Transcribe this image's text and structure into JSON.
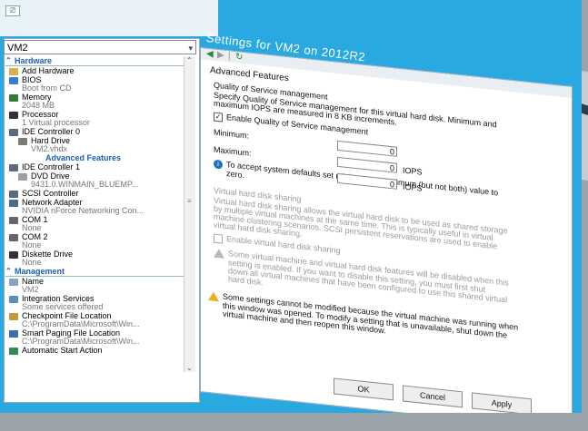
{
  "window": {
    "title": "Settings for VM2 on 2012R2",
    "controls": {
      "minimize": "–",
      "maximize": "□",
      "close": "✕"
    }
  },
  "vm_selector": {
    "value": "VM2"
  },
  "tree": {
    "hardware_header": "Hardware",
    "items": [
      {
        "label": "Add Hardware",
        "sub": "",
        "icon": "add-hardware-icon",
        "color": "#d7b14a"
      },
      {
        "label": "BIOS",
        "sub": "Boot from CD",
        "icon": "bios-icon",
        "color": "#3a7bd5"
      },
      {
        "label": "Memory",
        "sub": "2048 MB",
        "icon": "memory-icon",
        "color": "#2e7d32"
      },
      {
        "label": "Processor",
        "sub": "1 Virtual processor",
        "icon": "processor-icon",
        "color": "#333333"
      },
      {
        "label": "IDE Controller 0",
        "sub": "",
        "icon": "ide-controller-icon",
        "color": "#5a6b7b"
      },
      {
        "label": "Hard Drive",
        "sub": "VM2.vhdx",
        "icon": "hard-drive-icon",
        "color": "#7a7a7a"
      },
      {
        "label": "Advanced Features",
        "sub": "",
        "icon": "",
        "color": "#1a5fb4"
      },
      {
        "label": "IDE Controller 1",
        "sub": "",
        "icon": "ide-controller-icon",
        "color": "#5a6b7b"
      },
      {
        "label": "DVD Drive",
        "sub": "9431.0.WINMAIN_BLUEMP...",
        "icon": "dvd-drive-icon",
        "color": "#9aa0a6"
      },
      {
        "label": "SCSI Controller",
        "sub": "",
        "icon": "scsi-controller-icon",
        "color": "#5a6b7b"
      },
      {
        "label": "Network Adapter",
        "sub": "NVIDIA nForce Networking Con...",
        "icon": "network-adapter-icon",
        "color": "#4a6a8a"
      },
      {
        "label": "COM 1",
        "sub": "None",
        "icon": "com-port-icon",
        "color": "#666666"
      },
      {
        "label": "COM 2",
        "sub": "None",
        "icon": "com-port-icon",
        "color": "#666666"
      },
      {
        "label": "Diskette Drive",
        "sub": "None",
        "icon": "diskette-drive-icon",
        "color": "#333333"
      }
    ],
    "management_header": "Management",
    "mgmt_items": [
      {
        "label": "Name",
        "sub": "VM2",
        "icon": "name-icon",
        "color": "#8aa2c0"
      },
      {
        "label": "Integration Services",
        "sub": "Some services offered",
        "icon": "integration-services-icon",
        "color": "#5a8fc0"
      },
      {
        "label": "Checkpoint File Location",
        "sub": "C:\\ProgramData\\Microsoft\\Win...",
        "icon": "checkpoint-icon",
        "color": "#c09a3a"
      },
      {
        "label": "Smart Paging File Location",
        "sub": "C:\\ProgramData\\Microsoft\\Win...",
        "icon": "smart-paging-icon",
        "color": "#3a6ea8"
      },
      {
        "label": "Automatic Start Action",
        "sub": "",
        "icon": "automatic-start-icon",
        "color": "#2e8b57"
      }
    ]
  },
  "panel": {
    "section_title": "Advanced Features",
    "qos_title": "Quality of Service management",
    "qos_desc1": "Specify Quality of Service management for this virtual hard disk. Minimum and",
    "qos_desc2": "maximum IOPS are measured in 8 KB increments.",
    "enable_qos": "Enable Quality of Service management",
    "minimum_label": "Minimum:",
    "minimum_value": "0",
    "maximum_label": "Maximum:",
    "maximum_value": "0",
    "iops": "IOPS",
    "defaults_note1": "To accept system defaults set minimum or maximum (but not both) value to",
    "defaults_note2": "zero.",
    "sharing_title": "Virtual hard disk sharing",
    "sharing_desc1": "Virtual hard disk sharing allows the virtual hard disk to be used as shared storage",
    "sharing_desc2": "by multiple virtual machines at the same time. This is typically useful in virtual",
    "sharing_desc3": "machine clustering scenarios. SCSI persistent reservations are used to enable",
    "sharing_desc4": "virtual hard disk sharing.",
    "enable_sharing": "Enable virtual hard disk sharing",
    "sharing_warn1": "Some virtual machine and virtual hard disk features will be disabled when this",
    "sharing_warn2": "setting is enabled. If you want to disable this setting, you must first shut",
    "sharing_warn3": "down all virtual machines that have been configured to use this shared virtual",
    "sharing_warn4": "hard disk.",
    "running_warn1": "Some settings cannot be modified because the virtual machine was running when",
    "running_warn2": "this window was opened. To modify a setting that is unavailable, shut down the",
    "running_warn3": "virtual machine and then reopen this window."
  },
  "buttons": {
    "ok": "OK",
    "cancel": "Cancel",
    "apply": "Apply"
  },
  "colors": {
    "accent": "#2aa9e1",
    "tree_header": "#1a5fb4",
    "warning": "#e8b21c",
    "info": "#1e72c2"
  }
}
